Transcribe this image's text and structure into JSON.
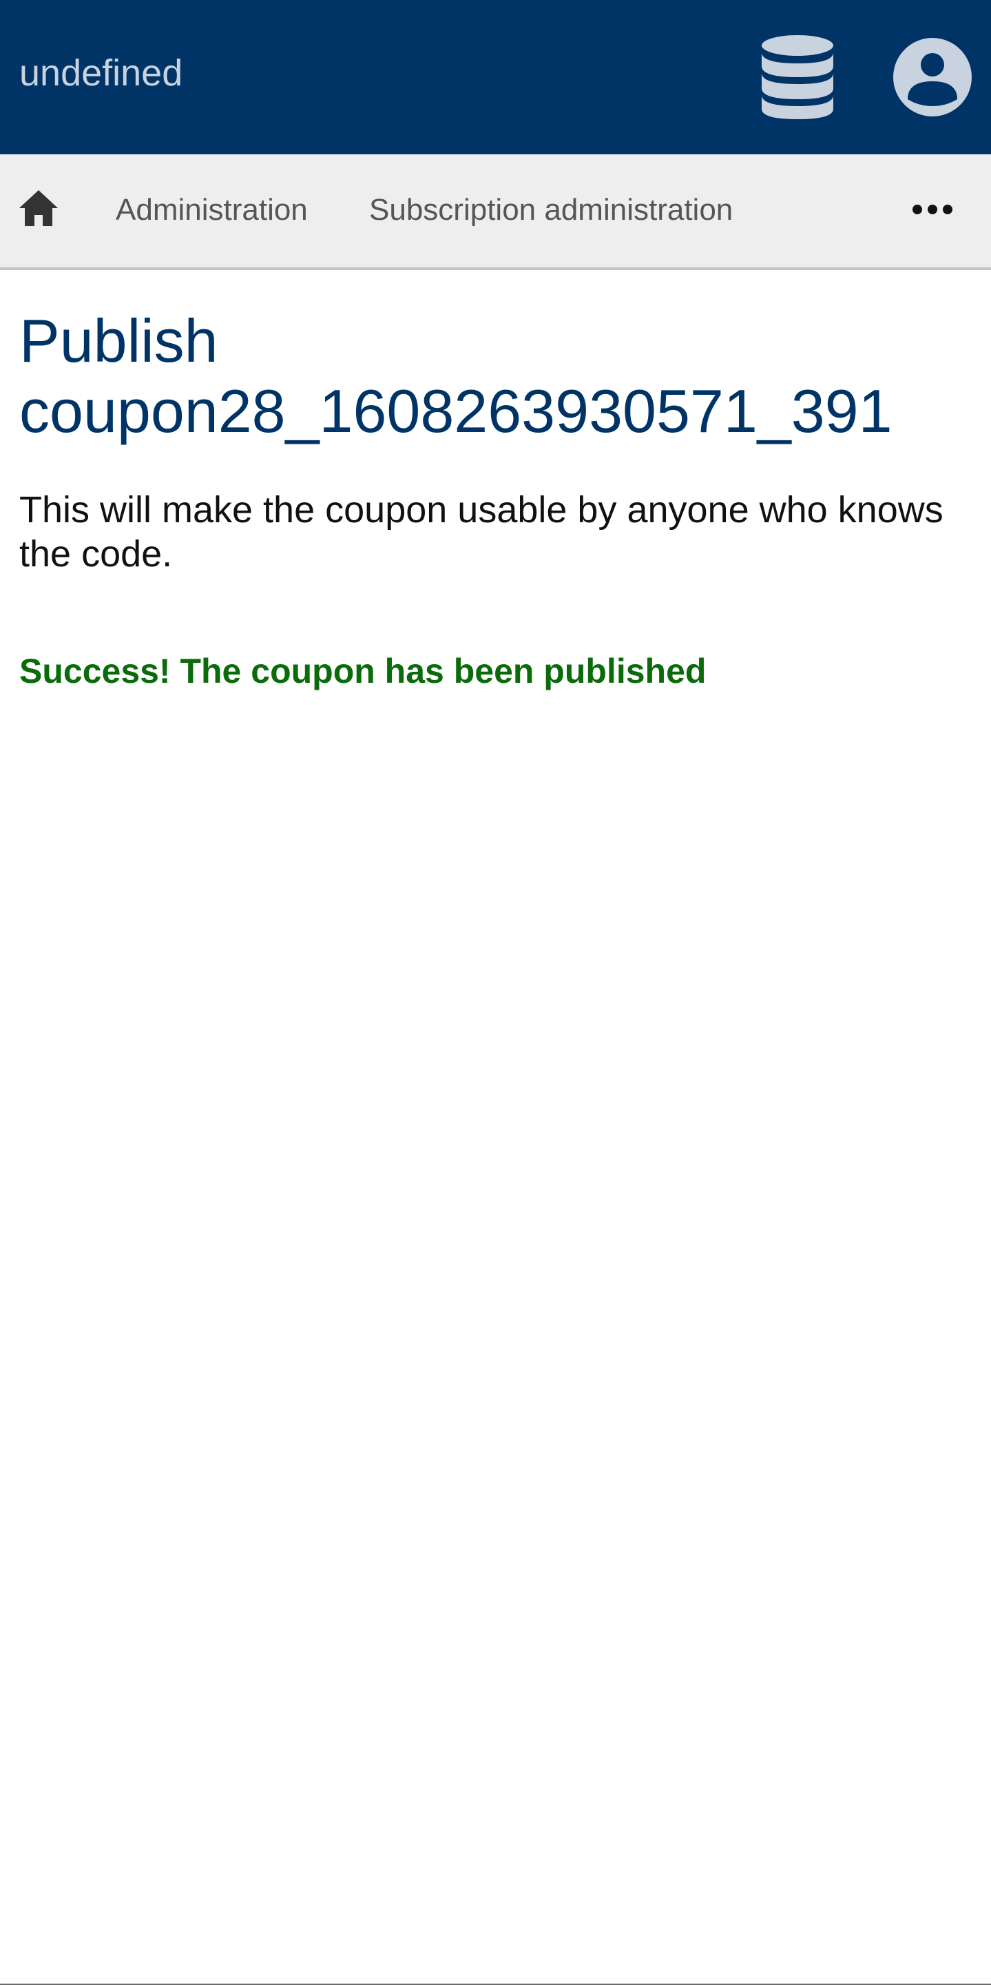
{
  "header": {
    "app_title": "undefined",
    "database_icon": "database-icon",
    "account_icon": "account-circle-icon"
  },
  "breadcrumb": {
    "home_icon": "home-icon",
    "items": [
      {
        "label": "Administration"
      },
      {
        "label": "Subscription administration"
      }
    ],
    "more_icon": "more-horizontal-icon"
  },
  "main": {
    "title": "Publish coupon28_1608263930571_391",
    "description": "This will make the coupon usable by anyone who knows the code.",
    "success_message": "Success! The coupon has been published"
  },
  "colors": {
    "header_background": "#003366",
    "breadcrumb_background": "#eeeeee",
    "title_color": "#003366",
    "success_color": "#0a6b0a",
    "icon_color": "#c9d3e0"
  }
}
